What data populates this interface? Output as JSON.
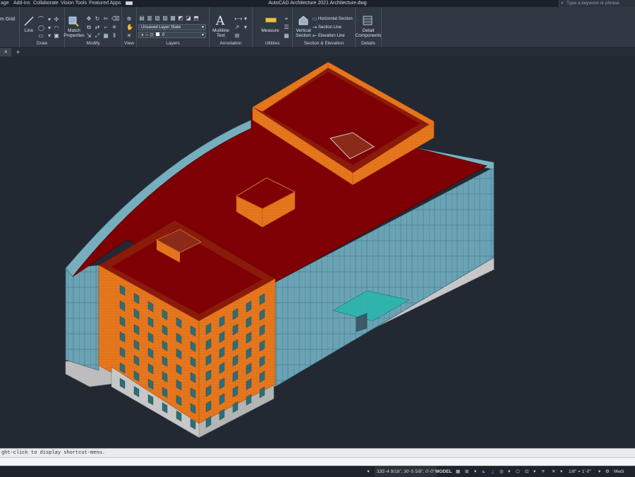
{
  "titlebar": {
    "tabs": [
      "age",
      "Add-ins",
      "Collaborate",
      "Vision Tools",
      "Featured Apps"
    ],
    "window_title": "AutoCAD Architecture 2021   Architecture.dwg",
    "search_placeholder": "Type a keyword or phrase"
  },
  "ribbon": {
    "grid_label": "m Grid",
    "draw": {
      "label": "Draw",
      "line_label": "Line"
    },
    "modify": {
      "label": "Modify",
      "match_properties": "Match Properties"
    },
    "view": {
      "label": "View"
    },
    "layers": {
      "label": "Layers",
      "layer_state": "Unsaved Layer State",
      "current_layer": "0"
    },
    "annotation": {
      "label": "Annotation",
      "multiline_text": "Multiline Text"
    },
    "utilities": {
      "label": "Utilities",
      "measure": "Measure"
    },
    "section_elevation": {
      "label": "Section & Elevation",
      "vertical_section": "Vertical Section",
      "horizontal_section": "Horizontal Section",
      "section_line": "Section Line",
      "elevation_line": "Elevation Line"
    },
    "details": {
      "label": "Details",
      "detail_components": "Detail Components"
    }
  },
  "command": {
    "history_text": "ght-click to display shortcut-menu."
  },
  "status": {
    "coordinates": "335'-4 9/16\", 30'-5 5/8\", 0'-0\"",
    "model": "MODEL",
    "scale": "1/8\" = 1'-0\"",
    "detail": "Medi"
  },
  "colors": {
    "background": "#222933",
    "roof": "#7e0004",
    "brick": "#e8781d",
    "glass": "#69a2b3",
    "base": "#c9c9c9",
    "canopy": "#2bb5ad"
  }
}
